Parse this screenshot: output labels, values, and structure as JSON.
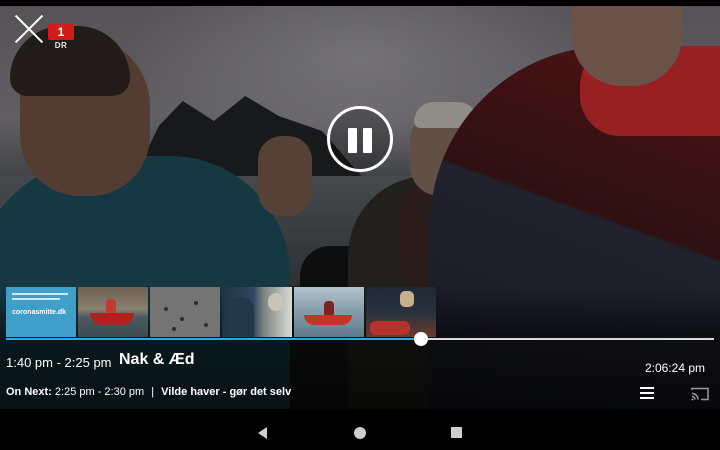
{
  "player": {
    "channel_logo": {
      "number": "1",
      "name": "DR"
    },
    "progress_fraction": 0.586
  },
  "program": {
    "time_range": "1:40 pm - 2:25 pm",
    "title": "Nak & Æd"
  },
  "clock": "2:06:24 pm",
  "on_next": {
    "label": "On Next:",
    "time_range": "2:25 pm - 2:30 pm",
    "separator": "|",
    "title": "Vilde haver - gør det selv"
  },
  "thumbnails": [
    {
      "text": "coronasmitte.dk"
    }
  ],
  "icons": {
    "close": "close-icon",
    "pause": "pause-icon",
    "menu": "menu-icon",
    "cast": "cast-icon",
    "back": "back-icon",
    "home": "home-icon",
    "recents": "recents-icon"
  },
  "colors": {
    "accent": "#29a8e0",
    "channel_red": "#d41b1b"
  }
}
